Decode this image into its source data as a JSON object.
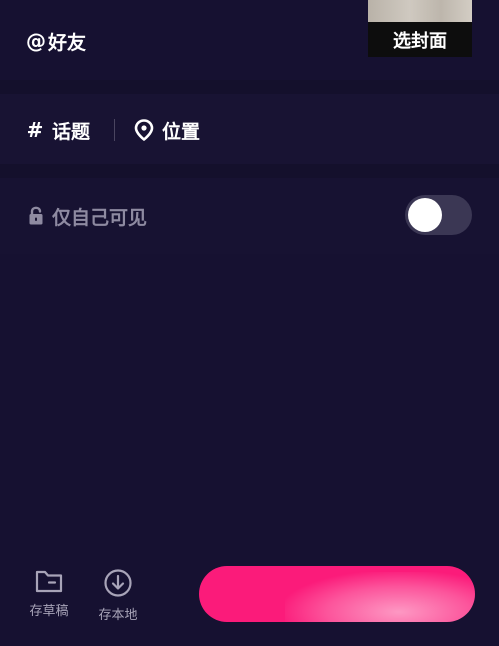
{
  "header": {
    "friends_icon": "@",
    "friends_label": "好友",
    "cover_label": "选封面"
  },
  "tags": {
    "topic_icon": "#",
    "topic_label": "话题",
    "location_label": "位置"
  },
  "privacy": {
    "label": "仅自己可见",
    "toggle_on": false
  },
  "bottom": {
    "draft_label": "存草稿",
    "local_label": "存本地"
  },
  "colors": {
    "background": "#161131",
    "accent": "#fb1b7a",
    "muted_text": "#8e8aa1",
    "toggle_track": "#3b3754"
  },
  "icons": [
    "at-icon",
    "hash-icon",
    "location-pin-icon",
    "lock-icon",
    "folder-icon",
    "download-icon"
  ]
}
